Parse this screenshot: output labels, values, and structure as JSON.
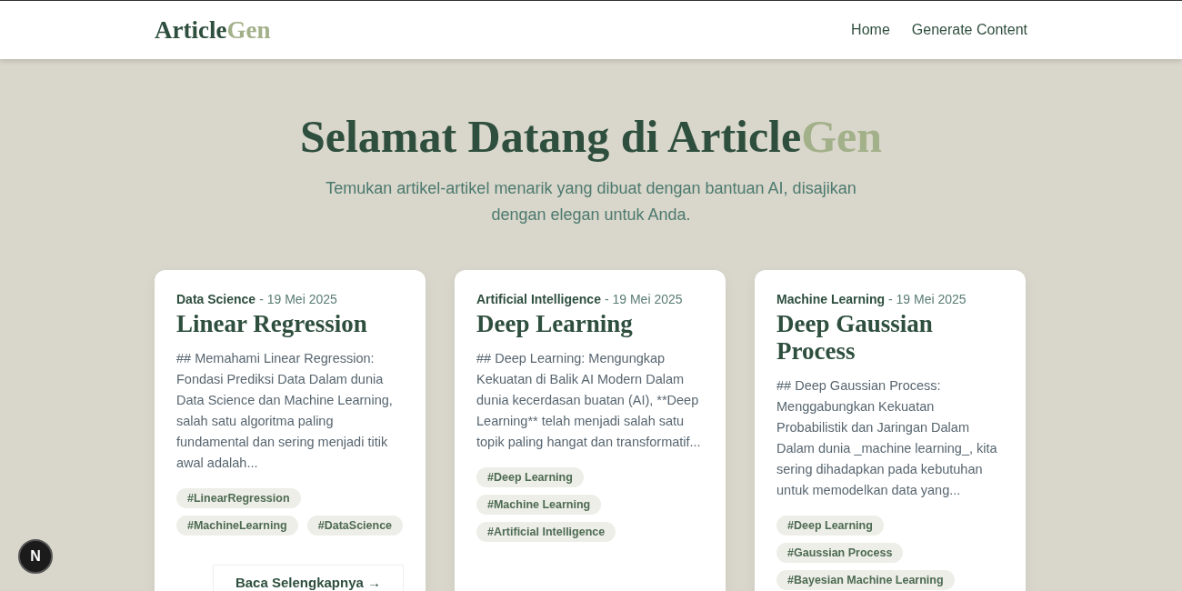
{
  "navbar": {
    "logo": {
      "main": "Article",
      "accent": "Gen"
    },
    "links": [
      "Home",
      "Generate Content"
    ]
  },
  "hero": {
    "title": {
      "main": "Selamat Datang di Article",
      "accent": "Gen"
    },
    "subtitle": "Temukan artikel-artikel menarik yang dibuat dengan bantuan AI, disajikan dengan elegan untuk Anda."
  },
  "articles": [
    {
      "category": "Data Science",
      "date": "- 19 Mei 2025",
      "title": "Linear Regression",
      "excerpt": "## Memahami Linear Regression: Fondasi Prediksi Data Dalam dunia Data Science dan Machine Learning, salah satu algoritma paling fundamental dan sering menjadi titik awal adalah...",
      "tags": [
        "#LinearRegression",
        "#MachineLearning",
        "#DataScience"
      ],
      "read_more": "Baca Selengkapnya →"
    },
    {
      "category": "Artificial Intelligence",
      "date": "- 19 Mei 2025",
      "title": "Deep Learning",
      "excerpt": "## Deep Learning: Mengungkap Kekuatan di Balik AI Modern Dalam dunia kecerdasan buatan (AI), **Deep Learning** telah menjadi salah satu topik paling hangat dan transformatif...",
      "tags": [
        "#Deep Learning",
        "#Machine Learning",
        "#Artificial Intelligence"
      ]
    },
    {
      "category": "Machine Learning",
      "date": "- 19 Mei 2025",
      "title": "Deep Gaussian Process",
      "excerpt": "## Deep Gaussian Process: Menggabungkan Kekuatan Probabilistik dan Jaringan Dalam Dalam dunia _machine learning_, kita sering dihadapkan pada kebutuhan untuk memodelkan data yang...",
      "tags": [
        "#Deep Learning",
        "#Gaussian Process",
        "#Bayesian Machine Learning"
      ]
    }
  ],
  "dev_badge": "N"
}
